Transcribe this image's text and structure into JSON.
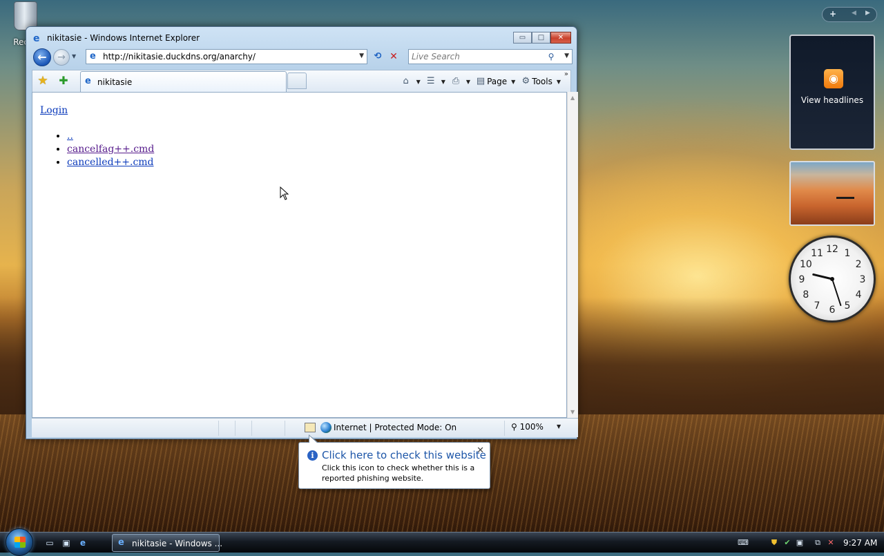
{
  "desktop": {
    "recycle_bin_label": "Recyc"
  },
  "window": {
    "title": "nikitasie - Windows Internet Explorer",
    "buttons": {
      "minimize": "▭",
      "maximize": "□",
      "close": "✕"
    }
  },
  "address_bar": {
    "url": "http://nikitasie.duckdns.org/anarchy/"
  },
  "search": {
    "placeholder": "Live Search"
  },
  "tabs": [
    {
      "label": "nikitasie"
    }
  ],
  "command_bar": {
    "page_label": "Page",
    "tools_label": "Tools"
  },
  "content": {
    "login_link": "Login",
    "files": [
      {
        "label": "..",
        "visited": false
      },
      {
        "label": "cancelfag++.cmd",
        "visited": true
      },
      {
        "label": "cancelled++.cmd",
        "visited": false
      }
    ]
  },
  "status_bar": {
    "zone": "Internet | Protected Mode: On",
    "zoom": "100%"
  },
  "balloon": {
    "title": "Click here to check this website",
    "body": "Click this icon to check whether this is a reported phishing website."
  },
  "gadgets": {
    "feed_label": "View headlines",
    "clock": {
      "hour": 9,
      "minute": 27
    }
  },
  "taskbar": {
    "task_label": "nikitasie - Windows ...",
    "time": "9:27 AM"
  },
  "colors": {
    "link": "#0c3bbb",
    "visited_link": "#551a8b",
    "balloon_title": "#1d56a8"
  }
}
